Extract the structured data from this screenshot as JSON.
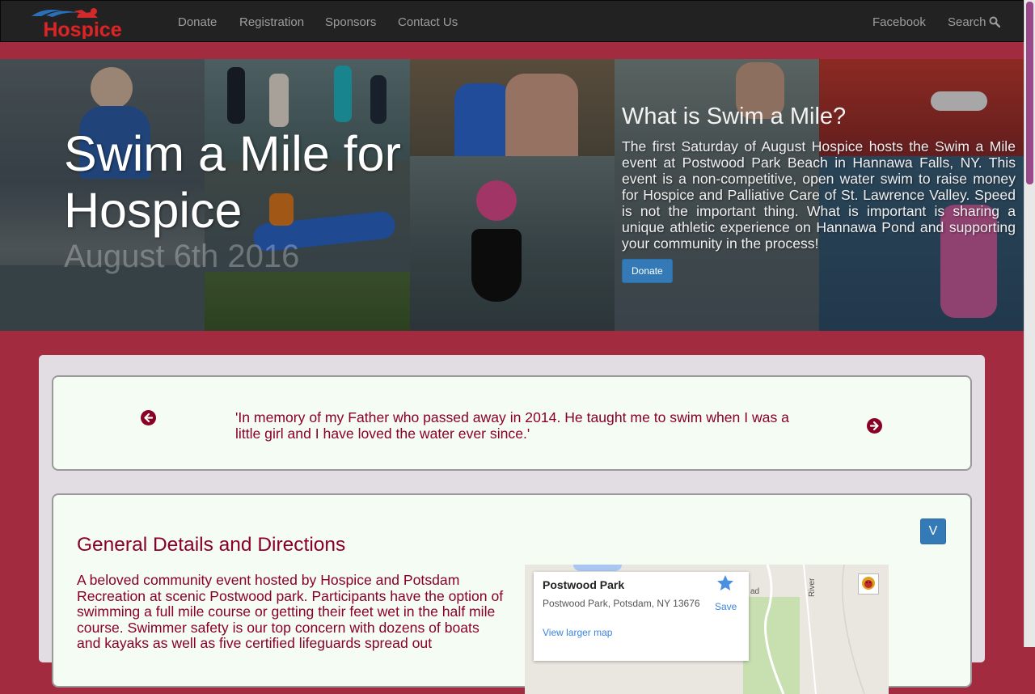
{
  "nav": {
    "logo_text": "Hospice",
    "links": [
      "Donate",
      "Registration",
      "Sponsors",
      "Contact Us"
    ],
    "right_links": [
      "Facebook",
      "Search"
    ],
    "search_icon": "search-icon"
  },
  "hero": {
    "title": "Swim a Mile for Hospice",
    "date": "August 6th 2016",
    "about_title": "What is Swim a Mile?",
    "about_text": "The first Saturday of August Hospice hosts the Swim a Mile event at Postwood Park Beach in Hannawa Falls, NY. This event is a non-competitive, open water swim to raise money for Hospice and Palliative Care of St. Lawrence Valley. Speed is not the important thing. What is important is sharing a unique athletic experience on Hannawa Pond and supporting your community in the process!",
    "donate_label": "Donate"
  },
  "testimonial": {
    "quote": "'In memory of my Father who passed away in 2014. He taught me to swim when I was a little girl and I have loved the water ever since.'",
    "prev_icon": "arrow-left-circle-icon",
    "next_icon": "arrow-right-circle-icon"
  },
  "details": {
    "toggle_label": "V",
    "title": "General Details and Directions",
    "text": "A beloved community event hosted by Hospice and Potsdam Recreation at scenic Postwood park. Participants have the option of swimming a full mile course or getting their feet wet in the half mile course. Swimmer safety is our top concern with dozens of boats and kayaks as well as five certified lifeguards spread out",
    "map": {
      "place": "Postwood Park",
      "address": "Postwood Park, Potsdam, NY 13676",
      "save_label": "Save",
      "larger_map_label": "View larger map",
      "river_label": "River",
      "road_label": "ad"
    }
  },
  "colors": {
    "brand_maroon": "#a22b3f",
    "text_maroon": "#8a0026",
    "button_blue": "#337ab7",
    "navbar": "#222222"
  }
}
